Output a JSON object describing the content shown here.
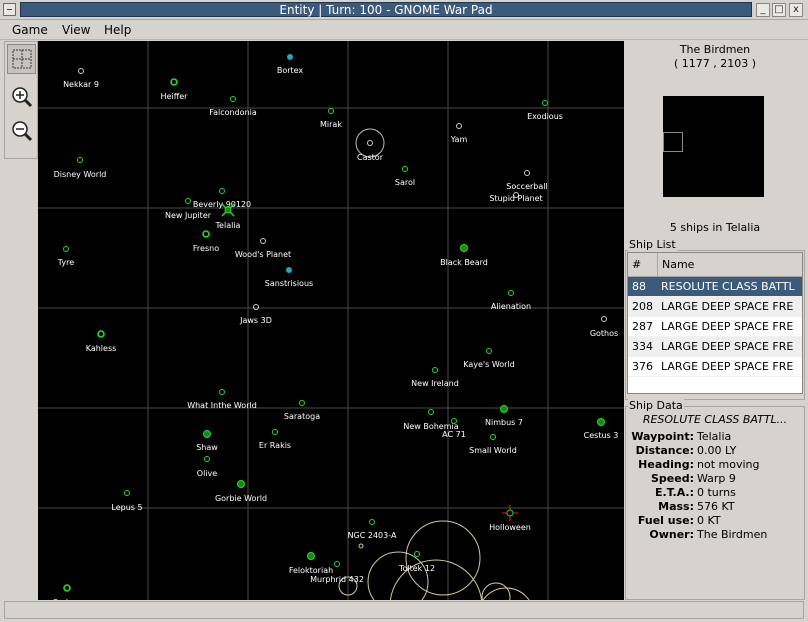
{
  "window": {
    "title": "Entity | Turn: 100 - GNOME War Pad",
    "minimize": "_",
    "maximize": "□",
    "close": "x"
  },
  "menu": {
    "game": "Game",
    "view": "View",
    "help": "Help"
  },
  "map": {
    "planets": [
      {
        "label": "Nekkar 9",
        "kind": "white"
      },
      {
        "label": "Heiffer",
        "kind": "green-big"
      },
      {
        "label": "Bortex",
        "kind": "cyan"
      },
      {
        "label": "Falcondonia",
        "kind": "green"
      },
      {
        "label": "Mirak",
        "kind": "green"
      },
      {
        "label": "Exodious",
        "kind": "green"
      },
      {
        "label": "Castor",
        "kind": "white"
      },
      {
        "label": "Yam",
        "kind": "white"
      },
      {
        "label": "Disney World",
        "kind": "green"
      },
      {
        "label": "Sarol",
        "kind": "green"
      },
      {
        "label": "Soccerball",
        "kind": "white"
      },
      {
        "label": "Stupid Planet",
        "kind": "white"
      },
      {
        "label": "Beverly 90120",
        "kind": "green"
      },
      {
        "label": "New Jupiter",
        "kind": "green"
      },
      {
        "label": "Telalia",
        "kind": "home"
      },
      {
        "label": "Fresno",
        "kind": "green-big"
      },
      {
        "label": "Wood's Planet",
        "kind": "white"
      },
      {
        "label": "Tyre",
        "kind": "green"
      },
      {
        "label": "Black Beard",
        "kind": "green-fill"
      },
      {
        "label": "Sanstrisious",
        "kind": "cyan"
      },
      {
        "label": "Alienation",
        "kind": "green"
      },
      {
        "label": "Jaws 3D",
        "kind": "white"
      },
      {
        "label": "Gothos",
        "kind": "white"
      },
      {
        "label": "Kahless",
        "kind": "green-big"
      },
      {
        "label": "Kaye's World",
        "kind": "green"
      },
      {
        "label": "New Ireland",
        "kind": "green"
      },
      {
        "label": "What Inthe World",
        "kind": "green"
      },
      {
        "label": "Saratoga",
        "kind": "green"
      },
      {
        "label": "New Bohemia",
        "kind": "green"
      },
      {
        "label": "AC 71",
        "kind": "green"
      },
      {
        "label": "Nimbus 7",
        "kind": "green-fill"
      },
      {
        "label": "Cestus 3",
        "kind": "green-fill"
      },
      {
        "label": "Shaw",
        "kind": "green-fill"
      },
      {
        "label": "Er Rakis",
        "kind": "green"
      },
      {
        "label": "Small World",
        "kind": "green"
      },
      {
        "label": "Olive",
        "kind": "green"
      },
      {
        "label": "Gorbie World",
        "kind": "green-fill"
      },
      {
        "label": "Lepus 5",
        "kind": "green"
      },
      {
        "label": "Holloween",
        "kind": "target"
      },
      {
        "label": "NGC 2403-A",
        "kind": "green"
      },
      {
        "label": "Toltek 12",
        "kind": "green"
      },
      {
        "label": "Feloktoriah",
        "kind": "green-fill"
      },
      {
        "label": "Murphrid 432",
        "kind": "green"
      },
      {
        "label": "Sadera",
        "kind": "green-big"
      }
    ]
  },
  "side": {
    "owner_name": "The Birdmen",
    "owner_coords": "( 1177 , 2103 )",
    "ships_count": "5 ships in Telalia",
    "ship_list_label": "Ship List",
    "col_id": "#",
    "col_name": "Name",
    "ships": [
      {
        "id": "88",
        "name": "RESOLUTE CLASS BATTL"
      },
      {
        "id": "208",
        "name": "LARGE DEEP SPACE FRE"
      },
      {
        "id": "287",
        "name": "LARGE DEEP SPACE FRE"
      },
      {
        "id": "334",
        "name": "LARGE DEEP SPACE FRE"
      },
      {
        "id": "376",
        "name": "LARGE DEEP SPACE FRE"
      }
    ],
    "ship_data_label": "Ship Data",
    "ship_title": "RESOLUTE CLASS BATTL...",
    "fields": [
      {
        "k": "Waypoint:",
        "v": "Telalia"
      },
      {
        "k": "Distance:",
        "v": "0.00 LY"
      },
      {
        "k": "Heading:",
        "v": "not moving"
      },
      {
        "k": "Speed:",
        "v": "Warp 9"
      },
      {
        "k": "E.T.A.:",
        "v": "0 turns"
      },
      {
        "k": "Mass:",
        "v": "576 KT"
      },
      {
        "k": "Fuel use:",
        "v": "0 KT"
      },
      {
        "k": "Owner:",
        "v": "The Birdmen"
      }
    ]
  },
  "colors": {
    "selection": "#3c5a7c",
    "green": "#22dd22",
    "cyan": "#22aabb",
    "grid": "#555555",
    "ion": "#cfc99a"
  }
}
